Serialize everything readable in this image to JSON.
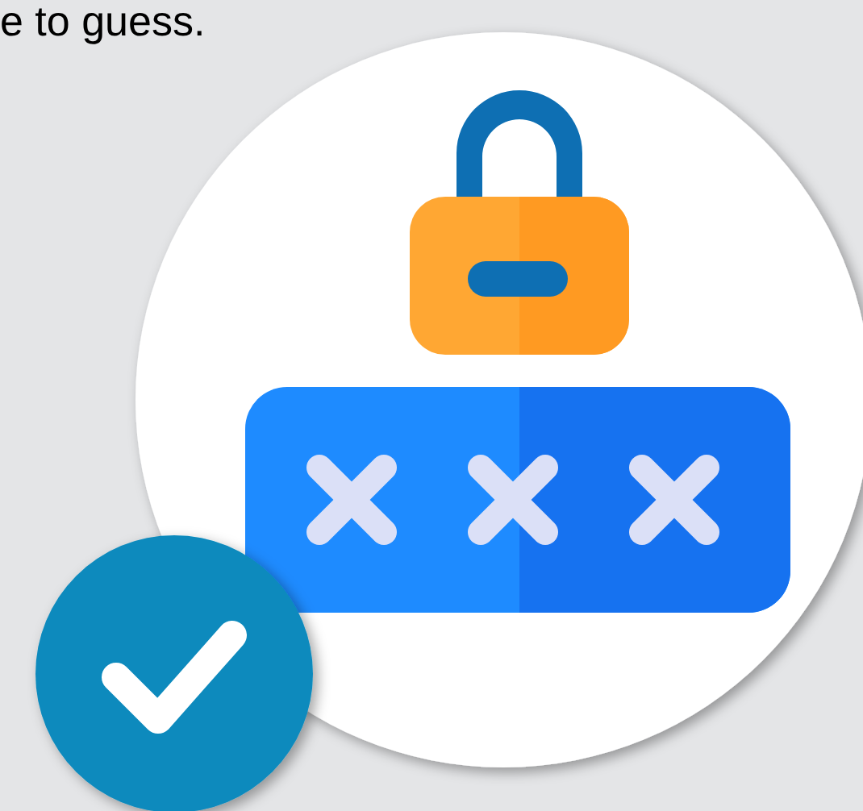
{
  "caption": {
    "text": "e to guess."
  }
}
